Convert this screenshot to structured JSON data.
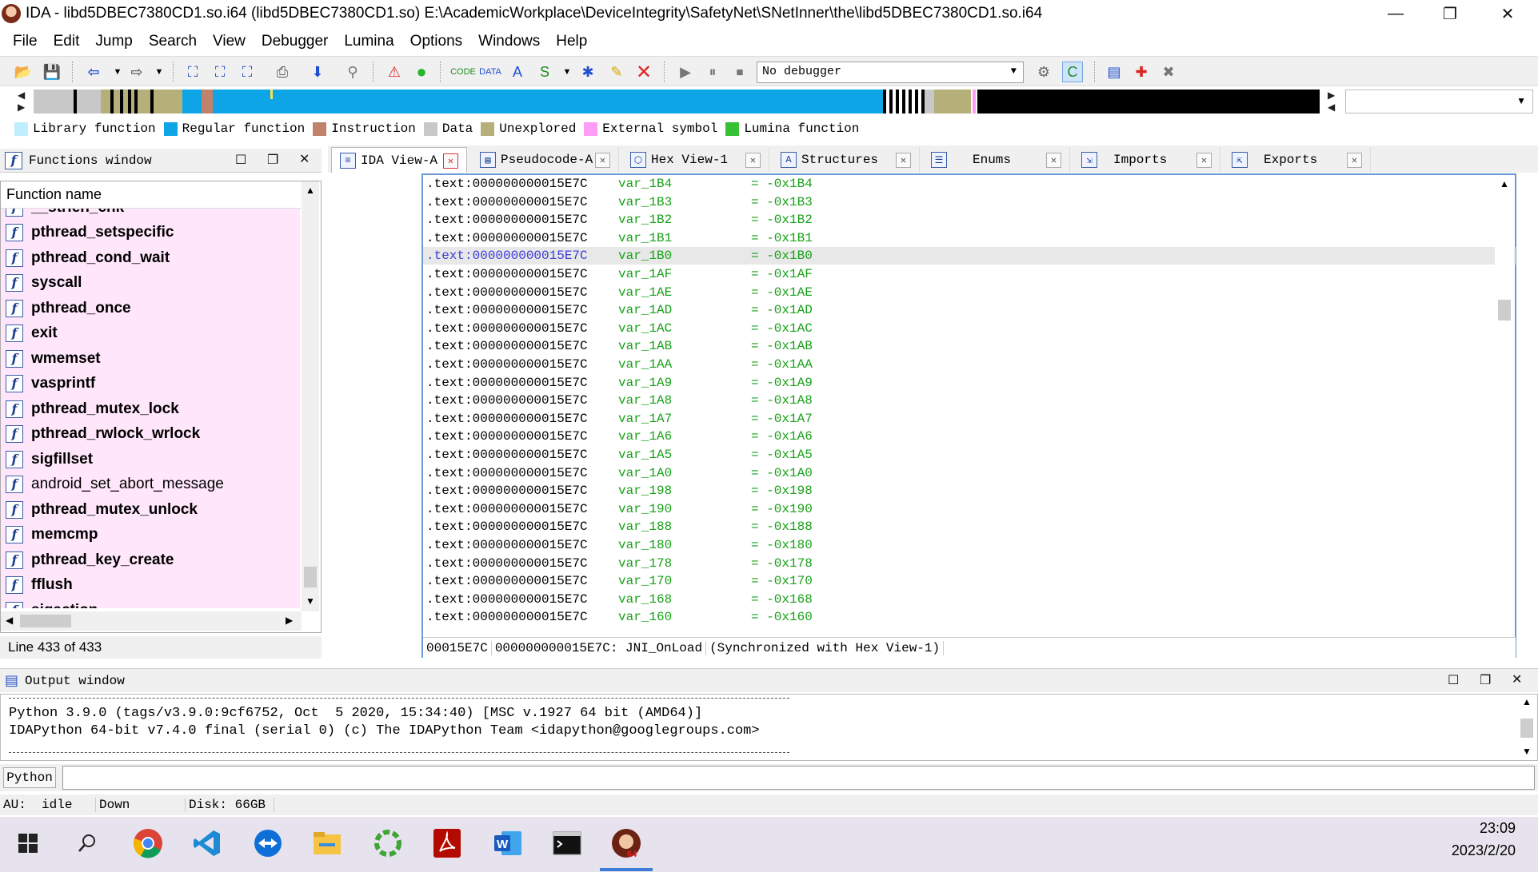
{
  "window": {
    "title": "IDA - libd5DBEC7380CD1.so.i64 (libd5DBEC7380CD1.so) E:\\AcademicWorkplace\\DeviceIntegrity\\SafetyNet\\SNetInner\\the\\libd5DBEC7380CD1.so.i64",
    "minimize": "—",
    "restore": "❐",
    "close": "✕"
  },
  "menu": [
    "File",
    "Edit",
    "Jump",
    "Search",
    "View",
    "Debugger",
    "Lumina",
    "Options",
    "Windows",
    "Help"
  ],
  "toolbar": {
    "debugger_select": "No debugger"
  },
  "legend": [
    {
      "label": "Library function",
      "color": "#bfefff"
    },
    {
      "label": "Regular function",
      "color": "#0ea5e6"
    },
    {
      "label": "Instruction",
      "color": "#c0826a"
    },
    {
      "label": "Data",
      "color": "#c8c8c8"
    },
    {
      "label": "Unexplored",
      "color": "#b5b07a"
    },
    {
      "label": "External symbol",
      "color": "#ff9cf5"
    },
    {
      "label": "Lumina function",
      "color": "#35c035"
    }
  ],
  "functions": {
    "title": "Functions window",
    "column": "Function name",
    "items": [
      {
        "name": "__strlen_chk",
        "bold": true
      },
      {
        "name": "pthread_setspecific",
        "bold": true
      },
      {
        "name": "pthread_cond_wait",
        "bold": true
      },
      {
        "name": "syscall",
        "bold": true
      },
      {
        "name": "pthread_once",
        "bold": true
      },
      {
        "name": "exit",
        "bold": true
      },
      {
        "name": "wmemset",
        "bold": true
      },
      {
        "name": "vasprintf",
        "bold": true
      },
      {
        "name": "pthread_mutex_lock",
        "bold": true
      },
      {
        "name": "pthread_rwlock_wrlock",
        "bold": true
      },
      {
        "name": "sigfillset",
        "bold": true
      },
      {
        "name": "android_set_abort_message",
        "bold": false
      },
      {
        "name": "pthread_mutex_unlock",
        "bold": true
      },
      {
        "name": "memcmp",
        "bold": true
      },
      {
        "name": "pthread_key_create",
        "bold": true
      },
      {
        "name": "fflush",
        "bold": true
      },
      {
        "name": "sigaction",
        "bold": true
      }
    ],
    "status": "Line 433 of 433"
  },
  "tabs": [
    {
      "label": "IDA View-A",
      "active": true
    },
    {
      "label": "Pseudocode-A",
      "active": false
    },
    {
      "label": "Hex View-1",
      "active": false
    },
    {
      "label": "Structures",
      "active": false
    },
    {
      "label": "Enums",
      "active": false
    },
    {
      "label": "Imports",
      "active": false
    },
    {
      "label": "Exports",
      "active": false
    }
  ],
  "disasm": {
    "lines": [
      {
        "addr": ".text:000000000015E7C",
        "name": "var_1B4",
        "value": "= -0x1B4"
      },
      {
        "addr": ".text:000000000015E7C",
        "name": "var_1B3",
        "value": "= -0x1B3"
      },
      {
        "addr": ".text:000000000015E7C",
        "name": "var_1B2",
        "value": "= -0x1B2"
      },
      {
        "addr": ".text:000000000015E7C",
        "name": "var_1B1",
        "value": "= -0x1B1"
      },
      {
        "addr": ".text:000000000015E7C",
        "name": "var_1B0",
        "value": "= -0x1B0",
        "highlight": true
      },
      {
        "addr": ".text:000000000015E7C",
        "name": "var_1AF",
        "value": "= -0x1AF"
      },
      {
        "addr": ".text:000000000015E7C",
        "name": "var_1AE",
        "value": "= -0x1AE"
      },
      {
        "addr": ".text:000000000015E7C",
        "name": "var_1AD",
        "value": "= -0x1AD"
      },
      {
        "addr": ".text:000000000015E7C",
        "name": "var_1AC",
        "value": "= -0x1AC"
      },
      {
        "addr": ".text:000000000015E7C",
        "name": "var_1AB",
        "value": "= -0x1AB"
      },
      {
        "addr": ".text:000000000015E7C",
        "name": "var_1AA",
        "value": "= -0x1AA"
      },
      {
        "addr": ".text:000000000015E7C",
        "name": "var_1A9",
        "value": "= -0x1A9"
      },
      {
        "addr": ".text:000000000015E7C",
        "name": "var_1A8",
        "value": "= -0x1A8"
      },
      {
        "addr": ".text:000000000015E7C",
        "name": "var_1A7",
        "value": "= -0x1A7"
      },
      {
        "addr": ".text:000000000015E7C",
        "name": "var_1A6",
        "value": "= -0x1A6"
      },
      {
        "addr": ".text:000000000015E7C",
        "name": "var_1A5",
        "value": "= -0x1A5"
      },
      {
        "addr": ".text:000000000015E7C",
        "name": "var_1A0",
        "value": "= -0x1A0"
      },
      {
        "addr": ".text:000000000015E7C",
        "name": "var_198",
        "value": "= -0x198"
      },
      {
        "addr": ".text:000000000015E7C",
        "name": "var_190",
        "value": "= -0x190"
      },
      {
        "addr": ".text:000000000015E7C",
        "name": "var_188",
        "value": "= -0x188"
      },
      {
        "addr": ".text:000000000015E7C",
        "name": "var_180",
        "value": "= -0x180"
      },
      {
        "addr": ".text:000000000015E7C",
        "name": "var_178",
        "value": "= -0x178"
      },
      {
        "addr": ".text:000000000015E7C",
        "name": "var_170",
        "value": "= -0x170"
      },
      {
        "addr": ".text:000000000015E7C",
        "name": "var_168",
        "value": "= -0x168"
      },
      {
        "addr": ".text:000000000015E7C",
        "name": "var_160",
        "value": "= -0x160"
      }
    ],
    "status_offset": "00015E7C",
    "status_location": "000000000015E7C: JNI_OnLoad",
    "status_sync": "(Synchronized with Hex View-1)"
  },
  "output": {
    "title": "Output window",
    "lines": [
      "Python 3.9.0 (tags/v3.9.0:9cf6752, Oct  5 2020, 15:34:40) [MSC v.1927 64 bit (AMD64)]",
      "IDAPython 64-bit v7.4.0 final (serial 0) (c) The IDAPython Team <idapython@googlegroups.com>"
    ],
    "python_label": "Python",
    "python_input": ""
  },
  "statusbar": {
    "au": "AU:  idle",
    "direction": "Down",
    "disk": "Disk: 66GB"
  },
  "taskbar": {
    "apps": [
      "windows-start-icon",
      "search-icon",
      "chrome-icon",
      "vscode-icon",
      "teamviewer-icon",
      "file-explorer-icon",
      "green-app-icon",
      "acrobat-icon",
      "word-icon",
      "terminal-icon",
      "ida-icon"
    ],
    "time": "23:09",
    "date": "2023/2/20"
  }
}
